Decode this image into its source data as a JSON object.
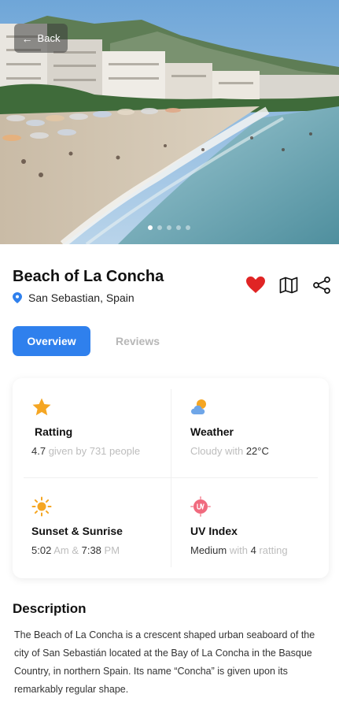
{
  "hero": {
    "back_label": "Back",
    "carousel_dots": 5,
    "active_dot": 0
  },
  "place": {
    "title": "Beach of La Concha",
    "location": "San Sebastian, Spain",
    "favorite_color": "#e02424"
  },
  "tabs": [
    {
      "label": "Overview",
      "active": true
    },
    {
      "label": "Reviews",
      "active": false
    }
  ],
  "info": {
    "rating": {
      "label": "Ratting",
      "score": "4.7",
      "given_by": " given by 731 people"
    },
    "weather": {
      "label": "Weather",
      "condition": "Cloudy with ",
      "temperature": "22°C"
    },
    "sun": {
      "label": "Sunset & Sunrise",
      "sunrise": "5:02",
      "am": " Am & ",
      "sunset": "7:38",
      "pm": " PM"
    },
    "uv": {
      "label": "UV Index",
      "level": "Medium",
      "with": " with ",
      "rating": "4",
      "suffix": " ratting"
    }
  },
  "description": {
    "title": "Description",
    "text": "The Beach of La Concha is a crescent shaped urban seaboard of the city of San Sebastián located at the Bay of La Concha in the Basque Country, in northern Spain. Its name “Concha” is given upon its remarkably regular shape."
  },
  "colors": {
    "accent": "#2f80ed",
    "star": "#f5a623",
    "sun": "#f5a623",
    "uv": "#f06a7e",
    "location_pin": "#2f80ed"
  }
}
